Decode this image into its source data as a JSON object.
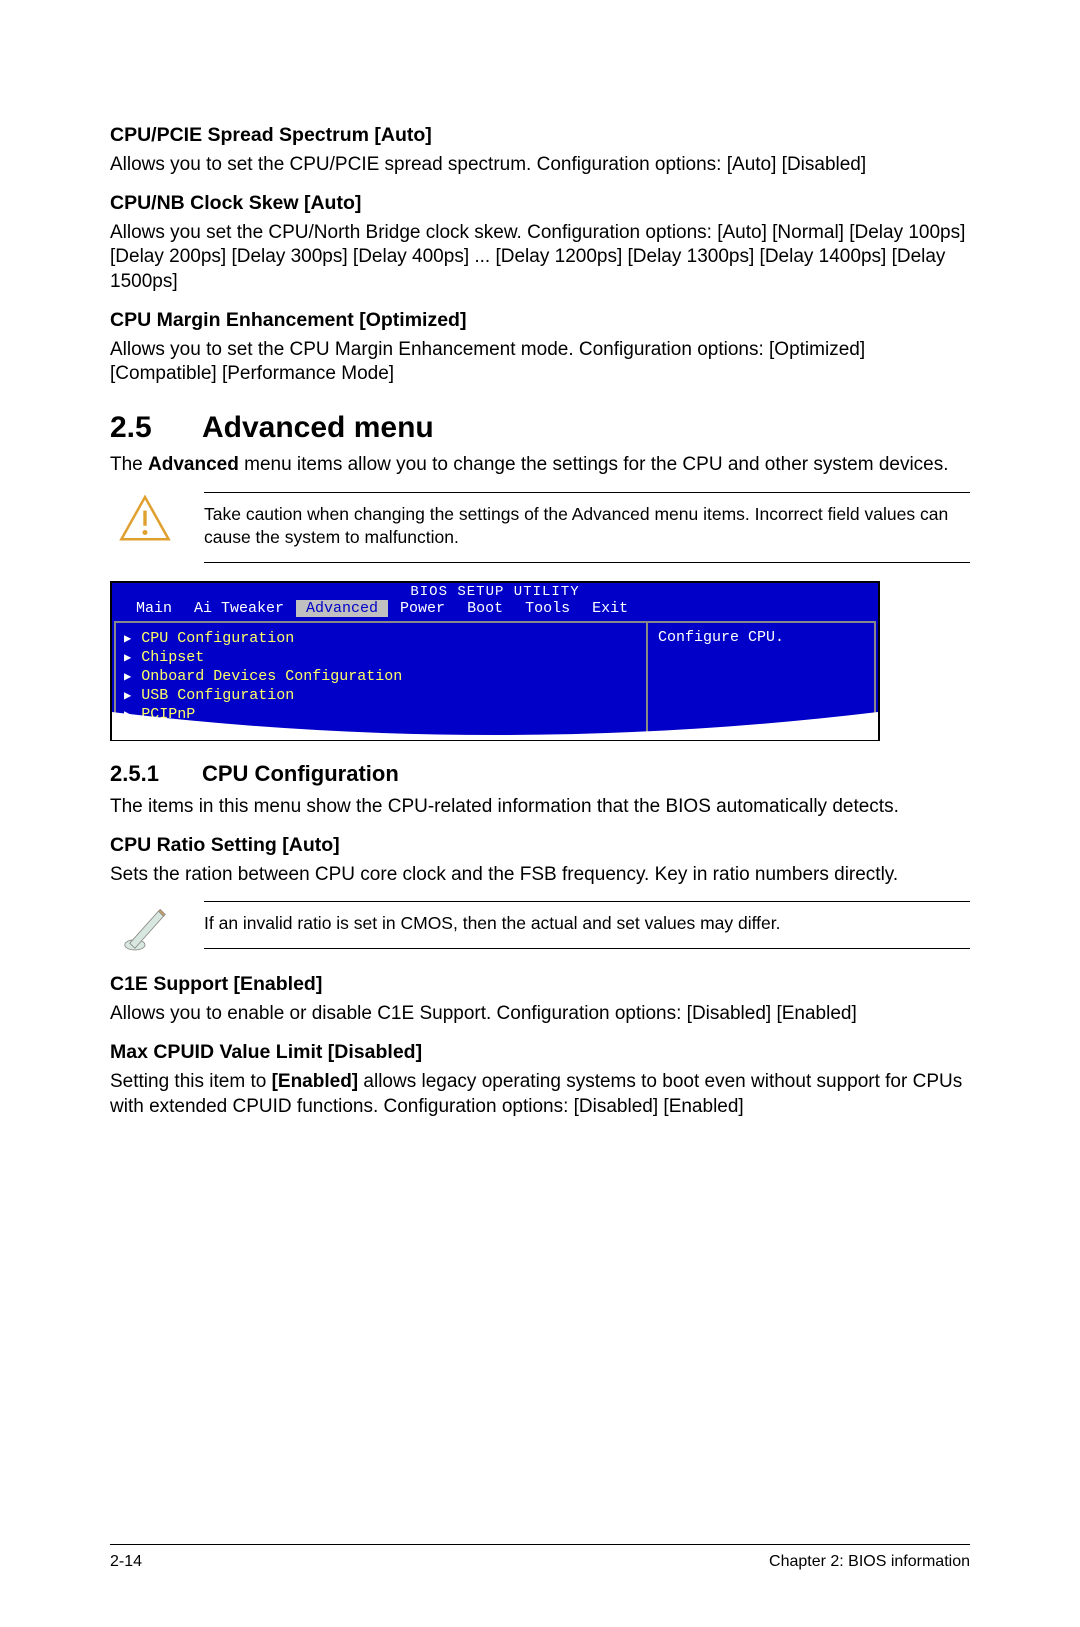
{
  "settings_top": [
    {
      "title": "CPU/PCIE Spread Spectrum [Auto]",
      "desc": "Allows you to set the CPU/PCIE spread spectrum. Configuration options: [Auto] [Disabled]"
    },
    {
      "title": "CPU/NB Clock Skew [Auto]",
      "desc": "Allows you set the CPU/North Bridge clock skew. Configuration options: [Auto] [Normal] [Delay 100ps] [Delay 200ps] [Delay 300ps] [Delay 400ps] ... [Delay 1200ps] [Delay 1300ps] [Delay 1400ps] [Delay 1500ps]"
    },
    {
      "title": "CPU Margin Enhancement [Optimized]",
      "desc": "Allows you to set the CPU Margin Enhancement mode. Configuration options: [Optimized] [Compatible] [Performance Mode]"
    }
  ],
  "section": {
    "num": "2.5",
    "title": "Advanced menu"
  },
  "section_intro_pre": "The ",
  "section_intro_bold": "Advanced",
  "section_intro_post": " menu items allow you to change the settings for the CPU and other system devices.",
  "warning": "Take caution when changing the settings of the Advanced menu items. Incorrect field values can cause the system to malfunction.",
  "bios": {
    "title": "BIOS SETUP UTILITY",
    "tabs": [
      "Main",
      "Ai Tweaker",
      "Advanced",
      "Power",
      "Boot",
      "Tools",
      "Exit"
    ],
    "active_tab": "Advanced",
    "items": [
      "CPU Configuration",
      "Chipset",
      "Onboard Devices Configuration",
      "USB Configuration",
      "PCIPnP"
    ],
    "help": "Configure CPU."
  },
  "subsection": {
    "num": "2.5.1",
    "title": "CPU Configuration"
  },
  "subsection_intro": "The items in this menu show the CPU-related information that the BIOS automatically detects.",
  "cpu_ratio": {
    "title": "CPU Ratio Setting [Auto]",
    "desc": "Sets the ration between CPU core clock and the FSB frequency. Key in ratio numbers directly."
  },
  "note": "If an invalid ratio is set in CMOS, then the actual and set values may differ.",
  "c1e": {
    "title": "C1E Support [Enabled]",
    "desc": "Allows you to enable or disable C1E Support. Configuration options: [Disabled] [Enabled]"
  },
  "cpuid": {
    "title": "Max CPUID Value Limit [Disabled]",
    "desc_pre": "Setting this item to ",
    "desc_bold": "[Enabled]",
    "desc_post": " allows legacy operating systems to boot even without support for CPUs with extended CPUID functions. Configuration options: [Disabled] [Enabled]"
  },
  "footer": {
    "page": "2-14",
    "chapter": "Chapter 2: BIOS information"
  }
}
